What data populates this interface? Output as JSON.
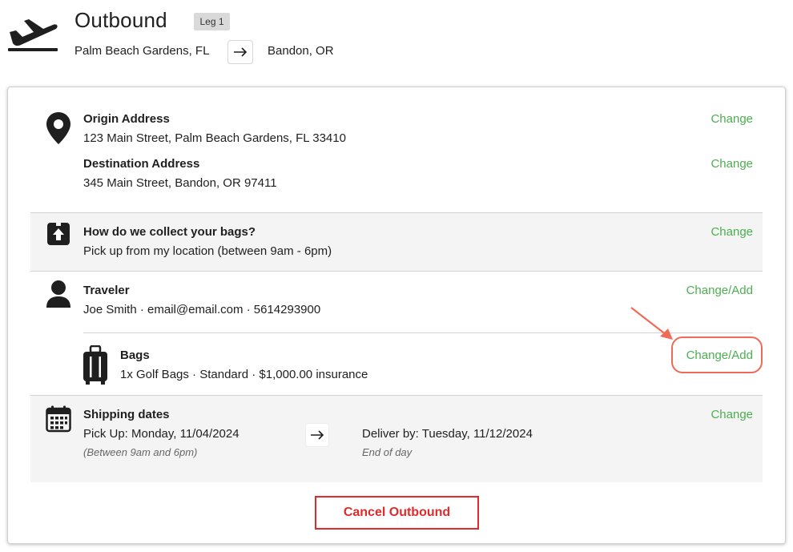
{
  "header": {
    "title": "Outbound",
    "leg_badge": "Leg 1",
    "route_from": "Palm Beach Gardens, FL",
    "route_to": "Bandon, OR"
  },
  "address": {
    "origin_label": "Origin Address",
    "origin_value": "123 Main Street, Palm Beach Gardens, FL 33410",
    "destination_label": "Destination Address",
    "destination_value": "345 Main Street, Bandon, OR 97411",
    "change_label": "Change"
  },
  "collection": {
    "label": "How do we collect your bags?",
    "value": "Pick up from my location (between 9am - 6pm)",
    "change_label": "Change"
  },
  "traveler": {
    "label": "Traveler",
    "value": "Joe Smith · email@email.com · 5614293900",
    "change_label": "Change/Add"
  },
  "bags": {
    "label": "Bags",
    "value": "1x Golf Bags · Standard · $1,000.00 insurance",
    "change_label": "Change/Add"
  },
  "shipping": {
    "label": "Shipping dates",
    "pickup": "Pick Up: Monday, 11/04/2024",
    "pickup_note": "(Between 9am and 6pm)",
    "deliver": "Deliver by: Tuesday, 11/12/2024",
    "deliver_note": "End of day",
    "change_label": "Change"
  },
  "actions": {
    "cancel_label": "Cancel Outbound"
  },
  "colors": {
    "link": "#4caf50",
    "danger": "#e12b2b",
    "annotation": "#ef6b57"
  }
}
